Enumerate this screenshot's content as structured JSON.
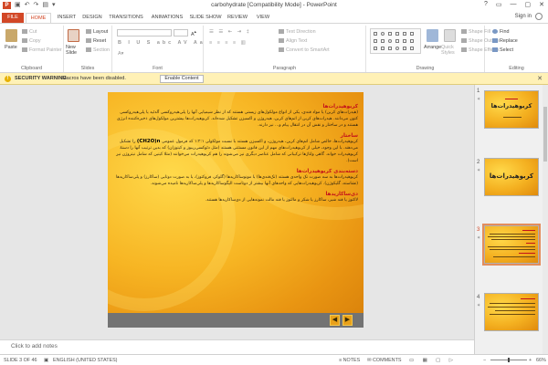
{
  "app": {
    "title": "carbohydrate [Compatibility Mode] - PowerPoint",
    "icon_letter": "P",
    "window_controls": [
      "?",
      "▭",
      "—",
      "▢",
      "✕"
    ],
    "sign_in": "Sign in",
    "brand_color": "#d24726"
  },
  "tabs": [
    "FILE",
    "HOME",
    "INSERT",
    "DESIGN",
    "TRANSITIONS",
    "ANIMATIONS",
    "SLIDE SHOW",
    "REVIEW",
    "VIEW"
  ],
  "ribbon": {
    "clipboard": {
      "paste": "Paste",
      "cut": "Cut",
      "copy": "Copy",
      "format_painter": "Format Painter",
      "label": "Clipboard"
    },
    "slides": {
      "new_slide": "New Slide",
      "layout": "Layout",
      "reset": "Reset",
      "section": "Section",
      "label": "Slides"
    },
    "font": {
      "font_size": "",
      "label": "Font"
    },
    "paragraph": {
      "text_direction": "Text Direction",
      "align_text": "Align Text",
      "convert_smartart": "Convert to SmartArt",
      "label": "Paragraph"
    },
    "drawing": {
      "arrange": "Arrange",
      "quick_styles": "Quick Styles",
      "shape_fill": "Shape Fill",
      "shape_outline": "Shape Outline",
      "shape_effects": "Shape Effects",
      "label": "Drawing"
    },
    "editing": {
      "find": "Find",
      "replace": "Replace",
      "select": "Select",
      "label": "Editing"
    }
  },
  "security_bar": {
    "label": "SECURITY WARNING",
    "message": "Macros have been disabled.",
    "button": "Enable Content"
  },
  "slide": {
    "heading1": "کربوهیدرات‌ها",
    "para1": "(هیدرات‌های کربن) یا مواد قندی، یکی از انواع مولکول‌های زیستی هستند که از نظر شیمیایی آنها را پلی‌هیدروکسی آلدئید یا پلی‌هیدروکسی کتون می‌دانند. هیدرات‌های کربن از اتم‌های کربن، هیدروژن و اکسیژن تشکیل شده‌اند. کربوهیدرات‌ها بیشترین مولکول‌های ذخیره‌کننده انرژی هستند و در ساختار و نقش آن در انتقال پیام و... نیز دارند.",
    "heading2": "ساختار",
    "para2": "کربوهیدرات‌ها، خالص شامل اتم‌های کربن، هیدروژن، و اکسیژن هستند با نسبت مولکولی ۱:۲:۱ که فرمول عمومی",
    "formula": "(CH2O)n",
    "para3": "را تشکیل می‌دهند. با این وجود، خیلی از کربوهیدرات‌های مهم از این قانون مستثنی هستند (مثل دئوکسی‌ریبوز و کیتوزان) که بدین ترتیب آنها را دستهٔ کربوهیدرات خواند. گاهی ولتاژها ترکیباتی که شامل عناصر دیگری نیز می‌شوند را هم کربوهیدرات می‌خوانند (مثلا کیتین که شامل نیتروژن نیز است).",
    "heading3": "دسته‌بندی کربوهیدرات‌ها",
    "para4": "کربوهیدرات‌ها به سه صورت تک واحدی هستند (تک‌قندی‌ها) یا مونوساکاریدها (گلوکز، فروکتوز)، یا به صورت دوتایی (ساکارز) و پلی‌ساکاریدها (نشاسته، گلیکوژن). کربوهیدرات‌هایی که واحدهای آنها بیشتر از دوتاست الیگوساکاریدها و پلی‌ساکاریدها نامیده می‌شوند.",
    "heading4": "دی‌ساکاریدها",
    "para5": "لاکتوز یا قند شیر، ساکارز یا شکر و مالتوز یا قند مالت نمونه‌هایی از دی‌ساکاریدها هستند.",
    "nav": [
      "◀",
      "▶"
    ]
  },
  "notes_placeholder": "Click to add notes",
  "thumbnails": [
    {
      "num": "1",
      "title": "کربوهیدرات‌ها"
    },
    {
      "num": "2",
      "title": "کربوهیدرات‌ها"
    },
    {
      "num": "3",
      "title": ""
    },
    {
      "num": "4",
      "title": ""
    }
  ],
  "status": {
    "slide_info": "SLIDE 3 OF 46",
    "language": "ENGLISH (UNITED STATES)",
    "notes": "NOTES",
    "comments": "COMMENTS",
    "zoom": "66%"
  }
}
